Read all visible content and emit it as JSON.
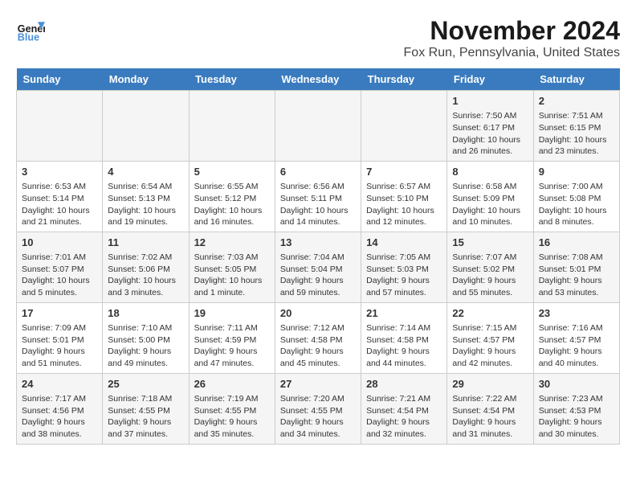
{
  "logo": {
    "text1": "General",
    "text2": "Blue"
  },
  "title": "November 2024",
  "subtitle": "Fox Run, Pennsylvania, United States",
  "headers": [
    "Sunday",
    "Monday",
    "Tuesday",
    "Wednesday",
    "Thursday",
    "Friday",
    "Saturday"
  ],
  "weeks": [
    [
      {
        "day": "",
        "info": ""
      },
      {
        "day": "",
        "info": ""
      },
      {
        "day": "",
        "info": ""
      },
      {
        "day": "",
        "info": ""
      },
      {
        "day": "",
        "info": ""
      },
      {
        "day": "1",
        "info": "Sunrise: 7:50 AM\nSunset: 6:17 PM\nDaylight: 10 hours and 26 minutes."
      },
      {
        "day": "2",
        "info": "Sunrise: 7:51 AM\nSunset: 6:15 PM\nDaylight: 10 hours and 23 minutes."
      }
    ],
    [
      {
        "day": "3",
        "info": "Sunrise: 6:53 AM\nSunset: 5:14 PM\nDaylight: 10 hours and 21 minutes."
      },
      {
        "day": "4",
        "info": "Sunrise: 6:54 AM\nSunset: 5:13 PM\nDaylight: 10 hours and 19 minutes."
      },
      {
        "day": "5",
        "info": "Sunrise: 6:55 AM\nSunset: 5:12 PM\nDaylight: 10 hours and 16 minutes."
      },
      {
        "day": "6",
        "info": "Sunrise: 6:56 AM\nSunset: 5:11 PM\nDaylight: 10 hours and 14 minutes."
      },
      {
        "day": "7",
        "info": "Sunrise: 6:57 AM\nSunset: 5:10 PM\nDaylight: 10 hours and 12 minutes."
      },
      {
        "day": "8",
        "info": "Sunrise: 6:58 AM\nSunset: 5:09 PM\nDaylight: 10 hours and 10 minutes."
      },
      {
        "day": "9",
        "info": "Sunrise: 7:00 AM\nSunset: 5:08 PM\nDaylight: 10 hours and 8 minutes."
      }
    ],
    [
      {
        "day": "10",
        "info": "Sunrise: 7:01 AM\nSunset: 5:07 PM\nDaylight: 10 hours and 5 minutes."
      },
      {
        "day": "11",
        "info": "Sunrise: 7:02 AM\nSunset: 5:06 PM\nDaylight: 10 hours and 3 minutes."
      },
      {
        "day": "12",
        "info": "Sunrise: 7:03 AM\nSunset: 5:05 PM\nDaylight: 10 hours and 1 minute."
      },
      {
        "day": "13",
        "info": "Sunrise: 7:04 AM\nSunset: 5:04 PM\nDaylight: 9 hours and 59 minutes."
      },
      {
        "day": "14",
        "info": "Sunrise: 7:05 AM\nSunset: 5:03 PM\nDaylight: 9 hours and 57 minutes."
      },
      {
        "day": "15",
        "info": "Sunrise: 7:07 AM\nSunset: 5:02 PM\nDaylight: 9 hours and 55 minutes."
      },
      {
        "day": "16",
        "info": "Sunrise: 7:08 AM\nSunset: 5:01 PM\nDaylight: 9 hours and 53 minutes."
      }
    ],
    [
      {
        "day": "17",
        "info": "Sunrise: 7:09 AM\nSunset: 5:01 PM\nDaylight: 9 hours and 51 minutes."
      },
      {
        "day": "18",
        "info": "Sunrise: 7:10 AM\nSunset: 5:00 PM\nDaylight: 9 hours and 49 minutes."
      },
      {
        "day": "19",
        "info": "Sunrise: 7:11 AM\nSunset: 4:59 PM\nDaylight: 9 hours and 47 minutes."
      },
      {
        "day": "20",
        "info": "Sunrise: 7:12 AM\nSunset: 4:58 PM\nDaylight: 9 hours and 45 minutes."
      },
      {
        "day": "21",
        "info": "Sunrise: 7:14 AM\nSunset: 4:58 PM\nDaylight: 9 hours and 44 minutes."
      },
      {
        "day": "22",
        "info": "Sunrise: 7:15 AM\nSunset: 4:57 PM\nDaylight: 9 hours and 42 minutes."
      },
      {
        "day": "23",
        "info": "Sunrise: 7:16 AM\nSunset: 4:57 PM\nDaylight: 9 hours and 40 minutes."
      }
    ],
    [
      {
        "day": "24",
        "info": "Sunrise: 7:17 AM\nSunset: 4:56 PM\nDaylight: 9 hours and 38 minutes."
      },
      {
        "day": "25",
        "info": "Sunrise: 7:18 AM\nSunset: 4:55 PM\nDaylight: 9 hours and 37 minutes."
      },
      {
        "day": "26",
        "info": "Sunrise: 7:19 AM\nSunset: 4:55 PM\nDaylight: 9 hours and 35 minutes."
      },
      {
        "day": "27",
        "info": "Sunrise: 7:20 AM\nSunset: 4:55 PM\nDaylight: 9 hours and 34 minutes."
      },
      {
        "day": "28",
        "info": "Sunrise: 7:21 AM\nSunset: 4:54 PM\nDaylight: 9 hours and 32 minutes."
      },
      {
        "day": "29",
        "info": "Sunrise: 7:22 AM\nSunset: 4:54 PM\nDaylight: 9 hours and 31 minutes."
      },
      {
        "day": "30",
        "info": "Sunrise: 7:23 AM\nSunset: 4:53 PM\nDaylight: 9 hours and 30 minutes."
      }
    ]
  ]
}
